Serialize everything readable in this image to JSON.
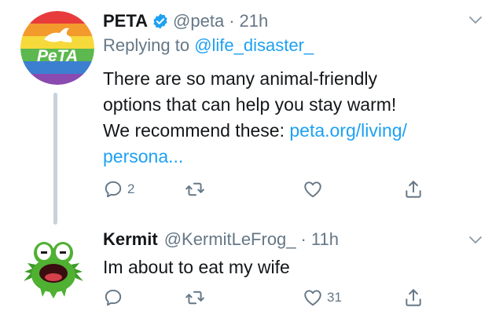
{
  "tweets": [
    {
      "name": "PETA",
      "handle": "@peta",
      "separator": "·",
      "time": "21h",
      "replying_prefix": "Replying to",
      "replying_to": "@life_disaster_",
      "avatar_text": "PeTA",
      "text_lines": [
        "There are so many animal-friendly",
        "options that can help you stay warm!",
        "We recommend these: "
      ],
      "link_part1": "peta.org/living/",
      "link_part2": "persona...",
      "reply_count": "2",
      "retweet_count": "",
      "like_count": "",
      "verified": true
    },
    {
      "name": "Kermit",
      "handle": "@KermitLeFrog_",
      "separator": "·",
      "time": "11h",
      "text": "Im about to eat my wife",
      "reply_count": "",
      "retweet_count": "",
      "like_count": "31"
    }
  ],
  "colors": {
    "link": "#1da1f2",
    "secondary": "#657786",
    "verified": "#1da1f2"
  },
  "icons": [
    "reply-icon",
    "retweet-icon",
    "like-icon",
    "share-icon",
    "chevron-down-icon",
    "verified-icon"
  ]
}
